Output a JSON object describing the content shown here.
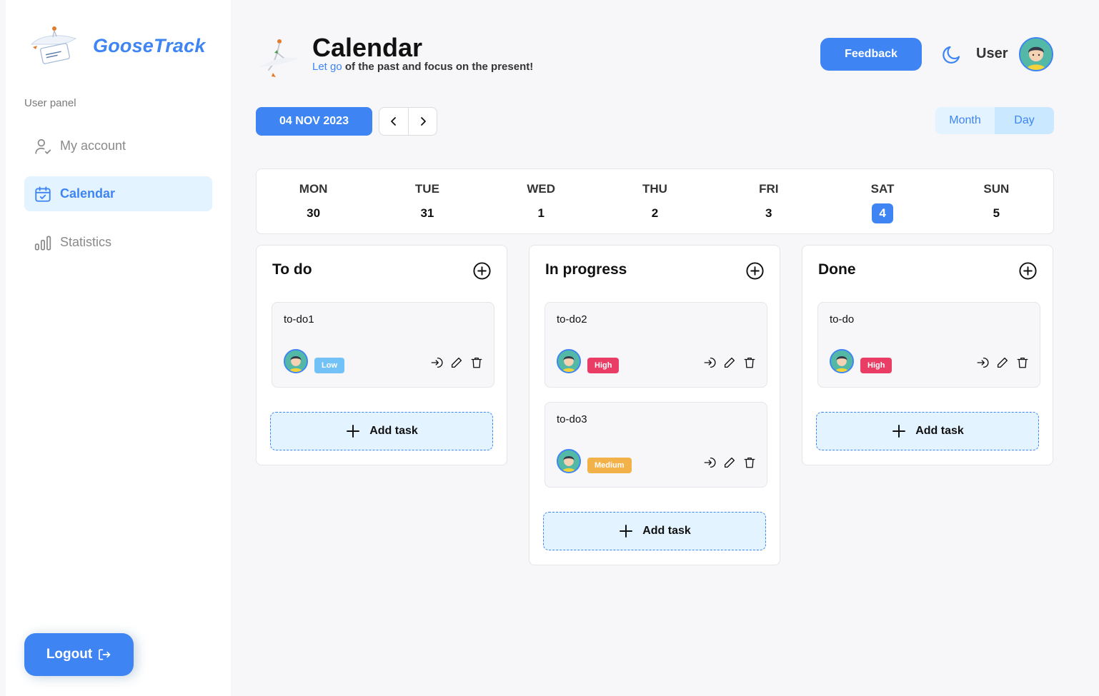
{
  "brand": {
    "name": "GooseTrack"
  },
  "sidebar": {
    "panel_label": "User panel",
    "items": [
      {
        "label": "My account",
        "icon": "user-check-icon"
      },
      {
        "label": "Calendar",
        "icon": "calendar-check-icon",
        "active": true
      },
      {
        "label": "Statistics",
        "icon": "chart-bars-icon"
      }
    ],
    "logout_label": "Logout"
  },
  "header": {
    "title": "Calendar",
    "motto_accent": "Let go",
    "motto_rest": " of the past and focus on the present!",
    "feedback_label": "Feedback",
    "user_name": "User"
  },
  "toolbar": {
    "date_label": "04 NOV 2023",
    "view_month": "Month",
    "view_day": "Day",
    "active_view": "Day"
  },
  "week": [
    {
      "name": "MON",
      "date": "30"
    },
    {
      "name": "TUE",
      "date": "31"
    },
    {
      "name": "WED",
      "date": "1"
    },
    {
      "name": "THU",
      "date": "2"
    },
    {
      "name": "FRI",
      "date": "3"
    },
    {
      "name": "SAT",
      "date": "4",
      "selected": true
    },
    {
      "name": "SUN",
      "date": "5"
    }
  ],
  "columns": [
    {
      "title": "To do",
      "add_label": "Add task",
      "tasks": [
        {
          "text": "to-do1",
          "priority": "Low"
        }
      ]
    },
    {
      "title": "In progress",
      "add_label": "Add task",
      "tasks": [
        {
          "text": "to-do2",
          "priority": "High"
        },
        {
          "text": "to-do3",
          "priority": "Medium"
        }
      ]
    },
    {
      "title": "Done",
      "add_label": "Add task",
      "tasks": [
        {
          "text": "to-do",
          "priority": "High"
        }
      ]
    }
  ],
  "colors": {
    "accent": "#3e85f3",
    "accent_light": "#e3f3ff",
    "priority_low": "#72c2f8",
    "priority_medium": "#f3b249",
    "priority_high": "#ea3d65"
  }
}
